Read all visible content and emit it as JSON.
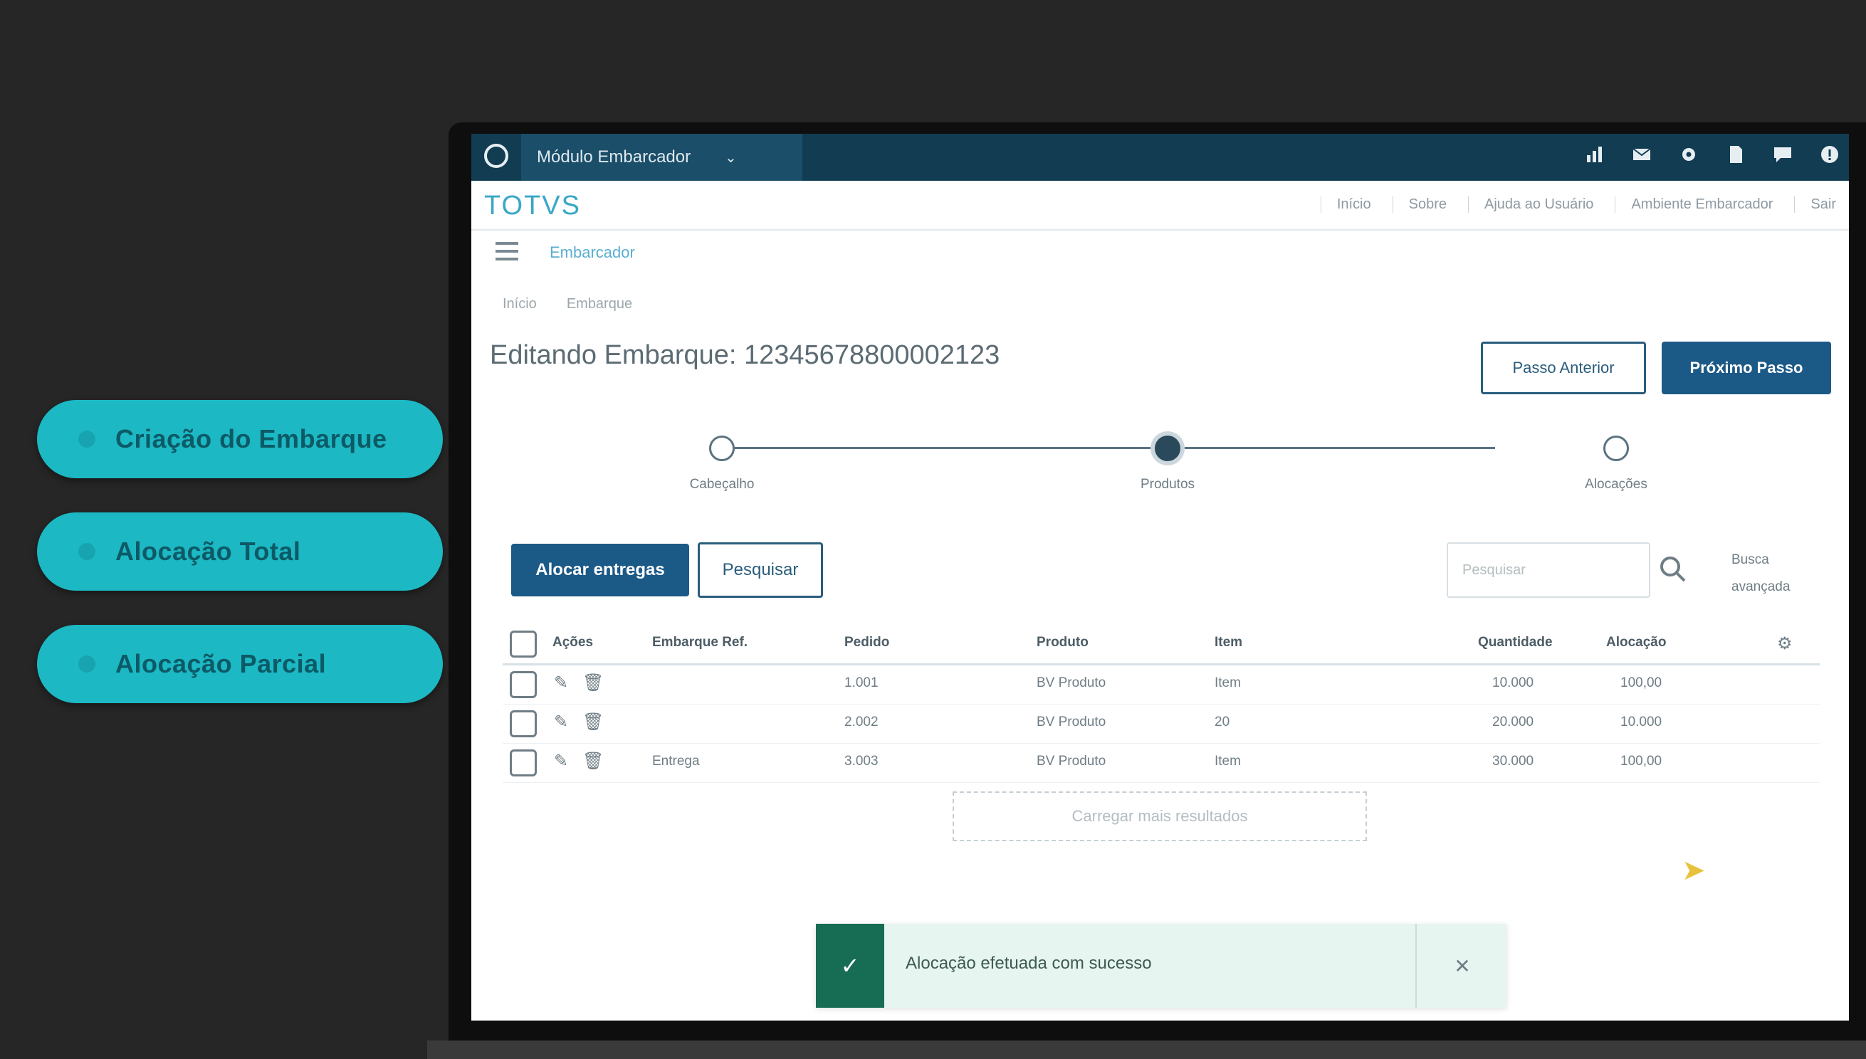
{
  "features": [
    {
      "label": "Criação do Embarque"
    },
    {
      "label": "Alocação Total"
    },
    {
      "label": "Alocação Parcial"
    }
  ],
  "topbar": {
    "tab_label": "Módulo Embarcador",
    "icons": [
      "bar-chart-icon",
      "mail-icon",
      "settings-icon",
      "document-icon",
      "chat-icon",
      "help-icon"
    ]
  },
  "brand": {
    "logo_text": "TOTVS",
    "links": [
      "Início",
      "Sobre",
      "Ajuda ao Usuário",
      "Ambiente Embarcador",
      "Sair"
    ]
  },
  "menu": {
    "module_name": "Embarcador"
  },
  "breadcrumb": [
    "Início",
    "Embarque"
  ],
  "page": {
    "title": "Editando Embarque: 12345678800002123",
    "prev_button": "Passo Anterior",
    "next_button": "Próximo Passo"
  },
  "stepper": {
    "steps": [
      {
        "label": "Cabeçalho",
        "state": "done"
      },
      {
        "label": "Produtos",
        "state": "active"
      },
      {
        "label": "Alocações",
        "state": "pending"
      }
    ]
  },
  "actions": {
    "add_button": "Alocar entregas",
    "secondary_button": "Pesquisar",
    "search_placeholder": "Pesquisar",
    "advanced_search": "Busca avançada"
  },
  "table": {
    "columns": [
      "Ações",
      "Embarque Ref.",
      "Pedido",
      "Produto",
      "Item",
      "Quantidade",
      "Alocação"
    ],
    "rows": [
      {
        "ref": "",
        "pedido": "1.001",
        "produto": "BV Produto",
        "item": "Item",
        "quantidade": "10.000",
        "alocacao": "100,00"
      },
      {
        "ref": "",
        "pedido": "2.002",
        "produto": "BV Produto",
        "item": "20",
        "quantidade": "20.000",
        "alocacao": "10.000"
      },
      {
        "ref": "Entrega",
        "pedido": "3.003",
        "produto": "BV Produto",
        "item": "Item",
        "quantidade": "30.000",
        "alocacao": "100,00"
      }
    ],
    "load_more": "Carregar mais resultados"
  },
  "toast": {
    "message": "Alocação efetuada com sucesso",
    "status_color": "#176d54"
  },
  "colors": {
    "accent": "#1cb8c4",
    "topbar": "#113c52",
    "primary_button": "#1b5987"
  }
}
